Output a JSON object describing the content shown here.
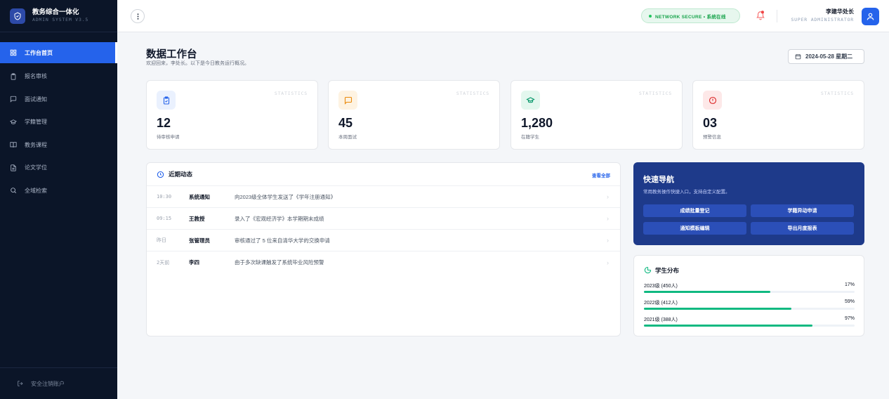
{
  "app": {
    "title": "教务综合一体化",
    "subtitle": "ADMIN SYSTEM V3.5"
  },
  "sidebar": {
    "items": [
      {
        "label": "工作台首页",
        "icon": "dashboard-icon",
        "active": true
      },
      {
        "label": "报名审核",
        "icon": "clipboard-icon"
      },
      {
        "label": "面试通知",
        "icon": "message-icon"
      },
      {
        "label": "学籍管理",
        "icon": "graduation-cap-icon"
      },
      {
        "label": "教务课程",
        "icon": "book-icon"
      },
      {
        "label": "论文学位",
        "icon": "document-icon"
      },
      {
        "label": "全域检索",
        "icon": "search-icon"
      }
    ],
    "logout": "安全注销账户"
  },
  "topbar": {
    "network": "NETWORK SECURE • 系统在线",
    "user_name": "李建华处长",
    "user_role": "SUPER ADMINISTRATOR"
  },
  "header": {
    "title": "数据工作台",
    "subtitle": "欢迎回来，李处长。以下是今日教务运行概况。",
    "date": "2024-05-28 星期二"
  },
  "stats": [
    {
      "value": "12",
      "label": "待审核申请",
      "tag": "STATISTICS",
      "icon": "clipboard-check-icon",
      "color": "#2563eb",
      "bg": "#eaf1fe"
    },
    {
      "value": "45",
      "label": "本周面试",
      "tag": "STATISTICS",
      "icon": "chat-icon",
      "color": "#ea8a0c",
      "bg": "#fef3e2"
    },
    {
      "value": "1,280",
      "label": "在籍学生",
      "tag": "STATISTICS",
      "icon": "graduation-cap-icon",
      "color": "#059669",
      "bg": "#e3f7ee"
    },
    {
      "value": "03",
      "label": "预警信息",
      "tag": "STATISTICS",
      "icon": "alert-icon",
      "color": "#dc2626",
      "bg": "#fde8e8"
    }
  ],
  "activity": {
    "title": "近期动态",
    "view_all": "查看全部",
    "rows": [
      {
        "time": "10:30",
        "who": "系统通知",
        "msg": "向2023级全体学生发送了《学年注册通知》"
      },
      {
        "time": "09:15",
        "who": "王教授",
        "msg": "录入了《宏观经济学》本学期期末成绩"
      },
      {
        "time": "昨日",
        "who": "张管理员",
        "msg": "审核通过了 5 位来自清华大学的交换申请"
      },
      {
        "time": "2天前",
        "who": "李四",
        "msg": "由于多次缺课触发了系统毕业风险预警"
      }
    ]
  },
  "quick_nav": {
    "title": "快速导航",
    "subtitle": "常用教务操作快捷入口，支持自定义配置。",
    "buttons": [
      "成绩批量登记",
      "学籍异动申请",
      "通知模板编辑",
      "导出月度报表"
    ]
  },
  "distribution": {
    "title": "学生分布",
    "rows": [
      {
        "label": "2023级 (450人)",
        "pct": "17%",
        "fill": 0.6
      },
      {
        "label": "2022级 (412人)",
        "pct": "59%",
        "fill": 0.7
      },
      {
        "label": "2021级 (388人)",
        "pct": "97%",
        "fill": 0.8
      }
    ]
  },
  "colors": {
    "accent": "#2563eb",
    "sidebar_bg": "#0b1528",
    "quick_nav_bg": "#1e3a8a",
    "bar": "#10b981"
  }
}
